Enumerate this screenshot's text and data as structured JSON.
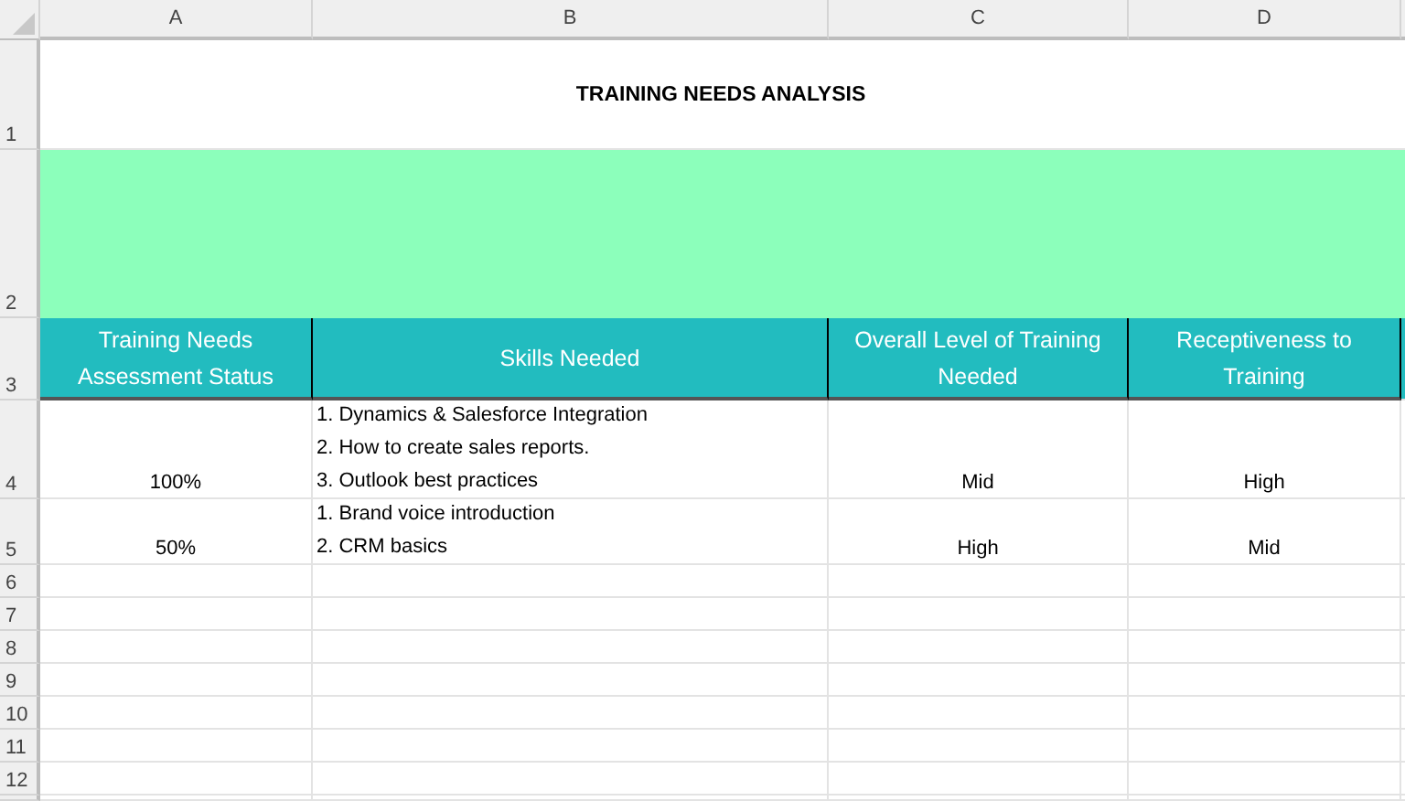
{
  "column_headers": [
    "A",
    "B",
    "C",
    "D"
  ],
  "row_numbers": [
    "1",
    "2",
    "3",
    "4",
    "5",
    "6",
    "7",
    "8",
    "9",
    "10",
    "11",
    "12"
  ],
  "title": "TRAINING NEEDS ANALYSIS",
  "table_headers": [
    "Training Needs Assessment Status",
    "Skills Needed",
    "Overall Level of Training Needed",
    "Receptiveness to Training"
  ],
  "rows": [
    {
      "status": "100%",
      "skills": [
        "1. Dynamics & Salesforce Integration",
        "2. How to create sales reports.",
        "3. Outlook best practices"
      ],
      "level": "Mid",
      "receptiveness": "High"
    },
    {
      "status": "50%",
      "skills": [
        "1. Brand voice introduction",
        "2. CRM basics"
      ],
      "level": "High",
      "receptiveness": "Mid"
    }
  ]
}
